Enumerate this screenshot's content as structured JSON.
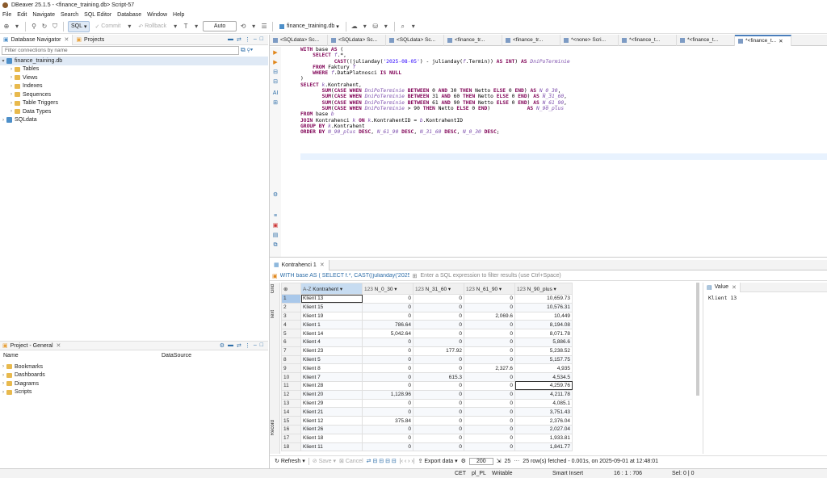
{
  "title": "DBeaver 25.1.5 - <finance_training.db> Script-57",
  "menu": [
    "File",
    "Edit",
    "Navigate",
    "Search",
    "SQL Editor",
    "Database",
    "Window",
    "Help"
  ],
  "toolbar": {
    "sql": "SQL",
    "commit": "Commit",
    "rollback": "Rollback",
    "auto": "Auto",
    "db": "finance_training.db"
  },
  "nav": {
    "tab1": "Database Navigator",
    "tab2": "Projects",
    "filter_placeholder": "Filter connections by name",
    "root": "finance_training.db",
    "items": [
      "Tables",
      "Views",
      "Indexes",
      "Sequences",
      "Table Triggers",
      "Data Types"
    ],
    "other": "SQLdata"
  },
  "project": {
    "title": "Project - General",
    "col_name": "Name",
    "col_ds": "DataSource",
    "items": [
      "Bookmarks",
      "Dashboards",
      "Diagrams",
      "Scripts"
    ]
  },
  "editor_tabs": [
    "<SQLdata> Sc...",
    "<SQLdata> Sc...",
    "<SQLdata> Sc...",
    "<finance_tr...",
    "<finance_tr...",
    "*<none> Scri...",
    "*<finance_t...",
    "*<finance_t...",
    "*<finance_t..."
  ],
  "result": {
    "tab": "Kontrahenci 1",
    "filter_query": "WITH base AS ( SELECT f.*, CAST((julianday('2025-08-05') -",
    "filter_placeholder": "Enter a SQL expression to filter results (use Ctrl+Space)",
    "columns": [
      "Kontrahent",
      "N_0_30",
      "N_31_60",
      "N_61_90",
      "N_90_plus"
    ],
    "col_types": [
      "A-Z",
      "123",
      "123",
      "123",
      "123"
    ],
    "rows": [
      [
        "Klient 13",
        "0",
        "0",
        "0",
        "10,659.73"
      ],
      [
        "Klient 15",
        "0",
        "0",
        "0",
        "10,576.31"
      ],
      [
        "Klient 19",
        "0",
        "0",
        "2,069.6",
        "10,449"
      ],
      [
        "Klient 1",
        "786.64",
        "0",
        "0",
        "8,194.08"
      ],
      [
        "Klient 14",
        "5,042.64",
        "0",
        "0",
        "8,071.78"
      ],
      [
        "Klient 4",
        "0",
        "0",
        "0",
        "5,886.6"
      ],
      [
        "Klient 23",
        "0",
        "177.92",
        "0",
        "5,238.52"
      ],
      [
        "Klient 5",
        "0",
        "0",
        "0",
        "5,157.75"
      ],
      [
        "Klient 8",
        "0",
        "0",
        "2,327.6",
        "4,935"
      ],
      [
        "Klient 7",
        "0",
        "615.3",
        "0",
        "4,534.5"
      ],
      [
        "Klient 28",
        "0",
        "0",
        "0",
        "4,259.76"
      ],
      [
        "Klient 20",
        "1,128.96",
        "0",
        "0",
        "4,211.78"
      ],
      [
        "Klient 29",
        "0",
        "0",
        "0",
        "4,085.1"
      ],
      [
        "Klient 21",
        "0",
        "0",
        "0",
        "3,751.43"
      ],
      [
        "Klient 12",
        "375.84",
        "0",
        "0",
        "2,376.04"
      ],
      [
        "Klient 26",
        "0",
        "0",
        "0",
        "2,027.04"
      ],
      [
        "Klient 18",
        "0",
        "0",
        "0",
        "1,933.81"
      ],
      [
        "Klient 11",
        "0",
        "0",
        "0",
        "1,841.77"
      ]
    ],
    "value_tab": "Value",
    "value_text": "Klient 13",
    "vtabs": [
      "Grid",
      "Text",
      "Record"
    ],
    "footer": {
      "refresh": "Refresh",
      "save": "Save",
      "cancel": "Cancel",
      "export": "Export data",
      "limit": "200",
      "count": "25",
      "fetched": "25 row(s) fetched - 0.001s, on 2025-09-01 at 12:48:01"
    }
  },
  "status": {
    "tz": "CET",
    "locale": "pl_PL",
    "mode": "Writable",
    "insert": "Smart Insert",
    "pos": "16 : 1 : 706",
    "sel": "Sel: 0 | 0"
  }
}
